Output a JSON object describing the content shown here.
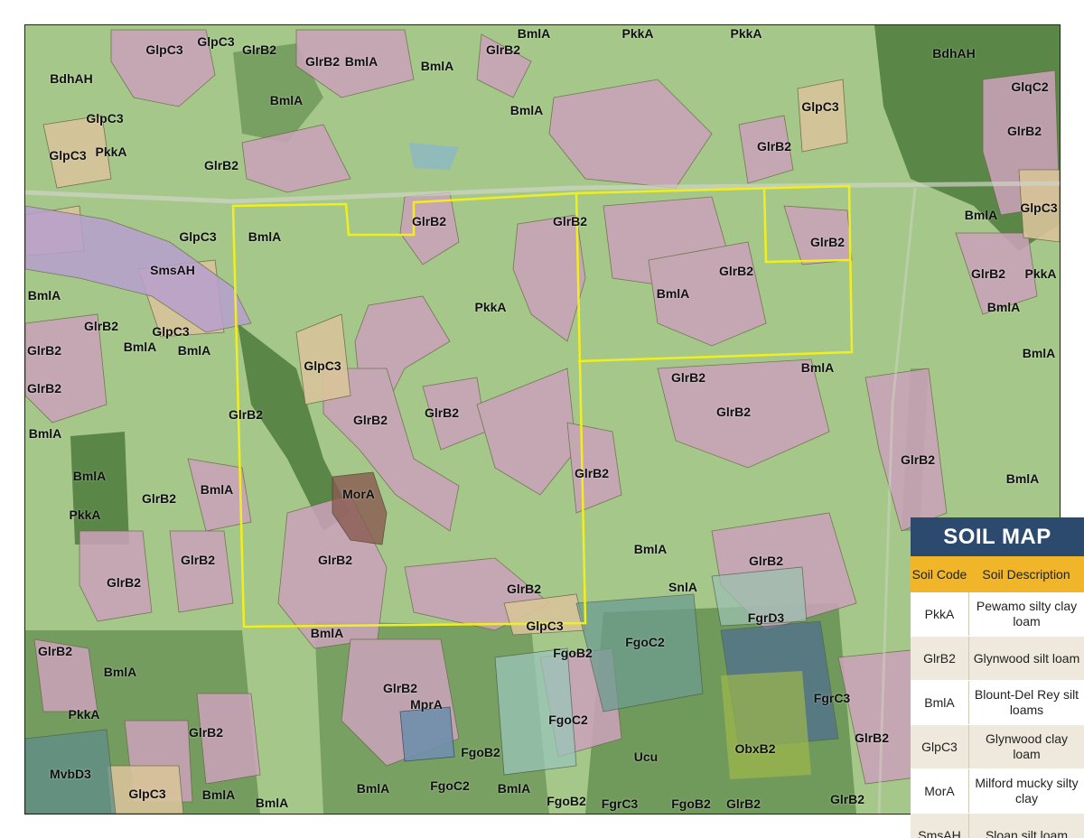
{
  "legend": {
    "title": "SOIL MAP",
    "header_code": "Soil Code",
    "header_description": "Soil Description",
    "rows": [
      {
        "code": "PkkA",
        "description": "Pewamo silty clay loam"
      },
      {
        "code": "GlrB2",
        "description": "Glynwood silt loam"
      },
      {
        "code": "BmlA",
        "description": "Blount-Del Rey silt loams"
      },
      {
        "code": "GlpC3",
        "description": "Glynwood clay loam"
      },
      {
        "code": "MorA",
        "description": "Milford mucky silty clay"
      },
      {
        "code": "SmsAH",
        "description": "Sloan silt loam"
      }
    ]
  },
  "colors": {
    "property_boundary": "#f2ee1e",
    "PkkA": "#a9c98a",
    "GlrB2": "#c9a2b8",
    "BmlA": "#b9dd9c",
    "GlpC3": "#d8c39a",
    "MorA": "#8a5a50",
    "SmsAH": "#b79fcf",
    "FgoC2": "#6d9c90",
    "MprA": "#6f8fae",
    "forest": "#3e6a32"
  },
  "soil_labels": [
    {
      "text": "GlpC3"
    },
    {
      "text": "GlpC3"
    },
    {
      "text": "GlrB2"
    },
    {
      "text": "BmlA"
    },
    {
      "text": "GlrB2"
    },
    {
      "text": "PkkA"
    },
    {
      "text": "PkkA"
    },
    {
      "text": "BdhAH"
    },
    {
      "text": "GlrB2"
    },
    {
      "text": "BmlA"
    },
    {
      "text": "BdhAH"
    },
    {
      "text": "GlqC2"
    },
    {
      "text": "BmlA"
    },
    {
      "text": "BmlA"
    },
    {
      "text": "GlpC3"
    },
    {
      "text": "GlpC3"
    },
    {
      "text": "BmlA"
    },
    {
      "text": "GlrB2"
    },
    {
      "text": "GlrB2"
    },
    {
      "text": "GlpC3"
    },
    {
      "text": "PkkA"
    },
    {
      "text": "GlrB2"
    },
    {
      "text": "GlrB2"
    },
    {
      "text": "GlrB2"
    },
    {
      "text": "BmlA"
    },
    {
      "text": "GlpC3"
    },
    {
      "text": "GlpC3"
    },
    {
      "text": "BmlA"
    },
    {
      "text": "GlrB2"
    },
    {
      "text": "GlrB2"
    },
    {
      "text": "PkkA"
    },
    {
      "text": "SmsAH"
    },
    {
      "text": "GlrB2"
    },
    {
      "text": "BmlA"
    },
    {
      "text": "BmlA"
    },
    {
      "text": "PkkA"
    },
    {
      "text": "BmlA"
    },
    {
      "text": "GlrB2"
    },
    {
      "text": "GlpC3"
    },
    {
      "text": "BmlA"
    },
    {
      "text": "BmlA"
    },
    {
      "text": "GlrB2"
    },
    {
      "text": "GlpC3"
    },
    {
      "text": "BmlA"
    },
    {
      "text": "GlrB2"
    },
    {
      "text": "BmlA"
    },
    {
      "text": "GlrB2"
    },
    {
      "text": "GlrB2"
    },
    {
      "text": "GlrB2"
    },
    {
      "text": "GlrB2"
    },
    {
      "text": "BmlA"
    },
    {
      "text": "GlrB2"
    },
    {
      "text": "GlrB2"
    },
    {
      "text": "BmlA"
    },
    {
      "text": "BmlA"
    },
    {
      "text": "GlrB2"
    },
    {
      "text": "MorA"
    },
    {
      "text": "PkkA"
    },
    {
      "text": "BmlA"
    },
    {
      "text": "GlrB2"
    },
    {
      "text": "GlrB2"
    },
    {
      "text": "GlrB2"
    },
    {
      "text": "GlrB2"
    },
    {
      "text": "GlrB2"
    },
    {
      "text": "SnlA"
    },
    {
      "text": "BmlA"
    },
    {
      "text": "GlpC3"
    },
    {
      "text": "FgoC2"
    },
    {
      "text": "FgrD3"
    },
    {
      "text": "GlrB2"
    },
    {
      "text": "BmlA"
    },
    {
      "text": "GlrB2"
    },
    {
      "text": "FgoB2"
    },
    {
      "text": "FgrC3"
    },
    {
      "text": "PkkA"
    },
    {
      "text": "GlrB2"
    },
    {
      "text": "MprA"
    },
    {
      "text": "FgoC2"
    },
    {
      "text": "GlrB2"
    },
    {
      "text": "GlrB2"
    },
    {
      "text": "FgoB2"
    },
    {
      "text": "Ucu"
    },
    {
      "text": "ObxB2"
    },
    {
      "text": "MvbD3"
    },
    {
      "text": "BmlA"
    },
    {
      "text": "FgoC2"
    },
    {
      "text": "GlpC3"
    },
    {
      "text": "BmlA"
    },
    {
      "text": "BmlA"
    },
    {
      "text": "BmlA"
    },
    {
      "text": "BmlA"
    },
    {
      "text": "FgoB2"
    },
    {
      "text": "FgrC3"
    },
    {
      "text": "FgoB2"
    },
    {
      "text": "GlrB2"
    },
    {
      "text": "GlrB2"
    }
  ]
}
